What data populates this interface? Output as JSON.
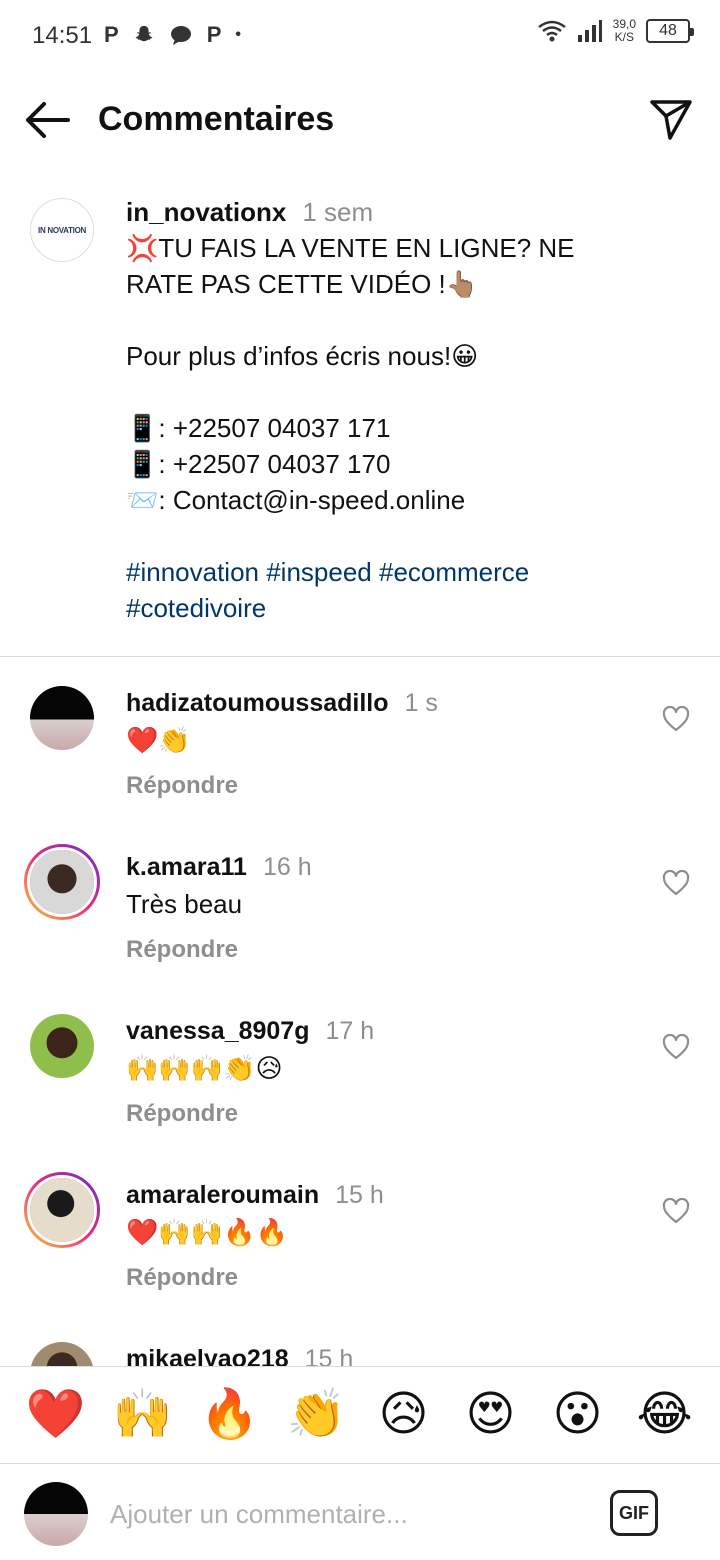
{
  "status_bar": {
    "time": "14:51",
    "notification_icons": [
      "P",
      "snapchat-icon",
      "chat-icon",
      "P",
      "•"
    ],
    "speed_value": "39,0",
    "speed_unit": "K/S",
    "battery": "48"
  },
  "header": {
    "title": "Commentaires",
    "back_icon": "arrow-left-icon",
    "send_icon": "paper-plane-icon"
  },
  "caption": {
    "avatar_logo": "IN NOVATION",
    "username": "in_novationx",
    "time": "1 sem",
    "lines": [
      "💢TU FAIS LA VENTE EN LIGNE? NE",
      "RATE PAS CETTE VIDÉO !👆🏽",
      "",
      "Pour plus d’infos écris nous!😀",
      "",
      "📱: +22507 04037 171",
      "📱: +22507 04037 170",
      "📨: Contact@in-speed.online",
      ""
    ],
    "hashtags_line1": "#innovation #inspeed #ecommerce",
    "hashtags_line2": "#cotedivoire"
  },
  "comments": [
    {
      "username": "hadizatoumoussadillo",
      "time": "1 s",
      "text": "❤️👏",
      "reply": "Répondre"
    },
    {
      "username": "k.amara11",
      "time": "16 h",
      "text": "Très beau",
      "reply": "Répondre"
    },
    {
      "username": "vanessa_8907g",
      "time": "17 h",
      "text": "🙌🙌🙌👏😥",
      "reply": "Répondre"
    },
    {
      "username": "amaraleroumain",
      "time": "15 h",
      "text": "❤️🙌🙌🔥🔥",
      "reply": "Répondre"
    },
    {
      "username": "mikaelyao218",
      "time": "15 h",
      "text": "",
      "reply": ""
    }
  ],
  "reactions": [
    "❤️",
    "🙌",
    "🔥",
    "👏",
    "😥",
    "😍",
    "😮",
    "😂"
  ],
  "composer": {
    "placeholder": "Ajouter un commentaire...",
    "gif_label": "GIF"
  },
  "colors": {
    "hashtag": "#00376b",
    "meta_gray": "#8e8e8e",
    "divider": "#dbdbdb",
    "story_ring": [
      "#f9ce34",
      "#ee2a7b",
      "#6228d7"
    ]
  }
}
